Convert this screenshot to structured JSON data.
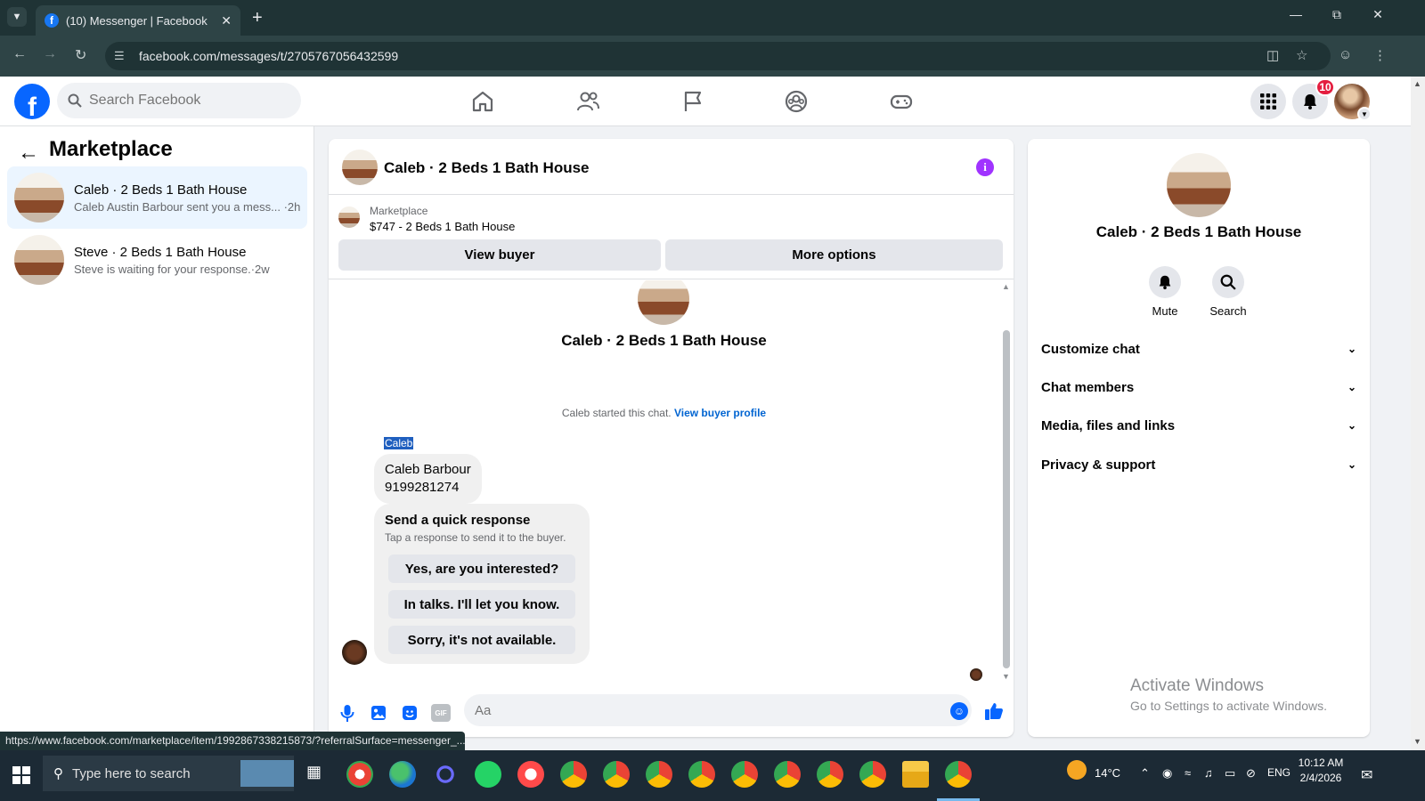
{
  "browser": {
    "tab_title": "(10) Messenger | Facebook",
    "url": "facebook.com/messages/t/2705767056432599",
    "status_url": "https://www.facebook.com/marketplace/item/1992867338215873/?referralSurface=messenger_..."
  },
  "fb_header": {
    "logo_letter": "f",
    "search_placeholder": "Search Facebook",
    "notification_count": "10"
  },
  "sidebar": {
    "title": "Marketplace",
    "conversations": [
      {
        "name": "Caleb · 2 Beds 1 Bath House",
        "preview": "Caleb Austin Barbour sent you a mess... ·2h",
        "active": true
      },
      {
        "name": "Steve · 2 Beds 1 Bath House",
        "preview": "Steve is waiting for your response.·2w",
        "active": false
      }
    ]
  },
  "chat": {
    "title": "Caleb · 2 Beds 1 Bath House",
    "marketplace_label": "Marketplace",
    "listing": "$747 - 2 Beds 1 Bath House",
    "view_buyer_label": "View buyer",
    "more_options_label": "More options",
    "intro_name": "Caleb · 2 Beds 1 Bath House",
    "started_text": "Caleb started this chat.",
    "view_profile_link": "View buyer profile",
    "sender_name": "Caleb",
    "message_line1": "Caleb Barbour",
    "message_line2": "9199281274",
    "quick_title": "Send a quick response",
    "quick_subtitle": "Tap a response to send it to the buyer.",
    "quick_responses": [
      "Yes, are you interested?",
      "In talks. I'll let you know.",
      "Sorry, it's not available."
    ],
    "composer_placeholder": "Aa",
    "gif_label": "GIF"
  },
  "details": {
    "name": "Caleb · 2 Beds 1 Bath House",
    "mute_label": "Mute",
    "search_label": "Search",
    "sections": [
      "Customize chat",
      "Chat members",
      "Media, files and links",
      "Privacy & support"
    ]
  },
  "watermark": {
    "line1": "Activate Windows",
    "line2": "Go to Settings to activate Windows."
  },
  "taskbar": {
    "search_placeholder": "Type here to search",
    "weather": "14°C",
    "language": "ENG",
    "time": "10:12 AM",
    "date": "2/4/2026"
  },
  "colors": {
    "fb_blue": "#0866ff",
    "messenger_purple": "#a033ff",
    "chrome_dark": "#1f3335"
  }
}
